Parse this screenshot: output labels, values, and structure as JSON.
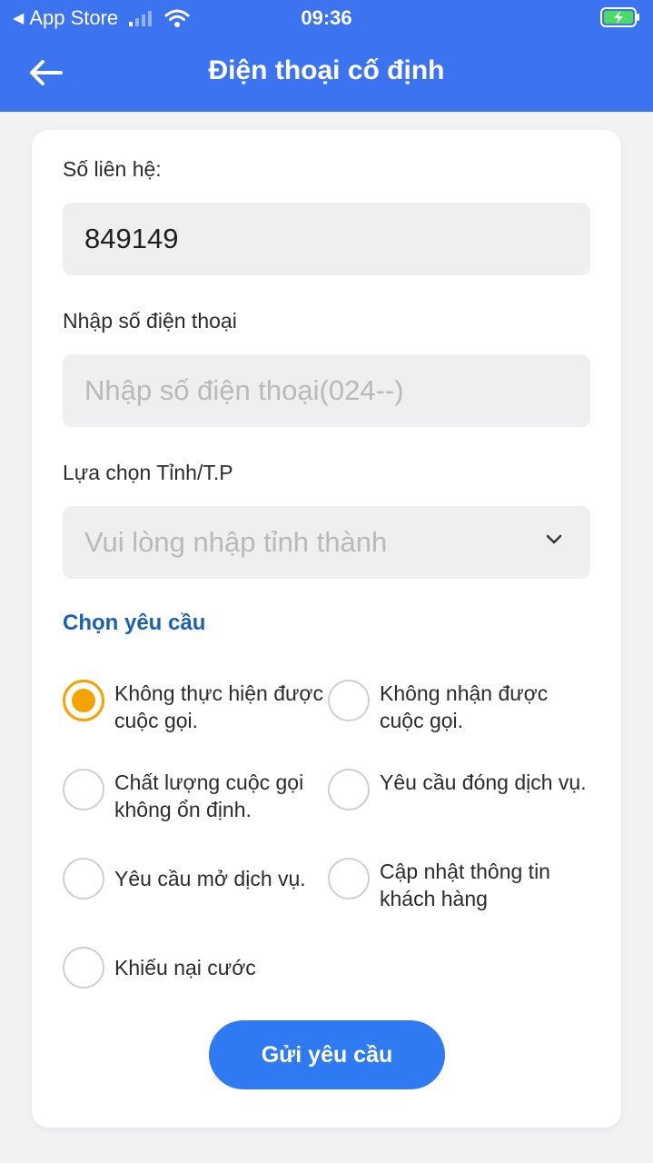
{
  "status_bar": {
    "back_app": "App Store",
    "time": "09:36"
  },
  "header": {
    "title": "Điện thoại cố định"
  },
  "form": {
    "contact_label": "Số liên hệ:",
    "contact_value": "849149",
    "phone_label": "Nhập số điện thoại",
    "phone_placeholder": "Nhập số điện thoại(024--)",
    "province_label": "Lựa chọn Tỉnh/T.P",
    "province_placeholder": "Vui lòng nhập tỉnh thành",
    "request_title": "Chọn yêu cầu",
    "options": [
      {
        "label": "Không thực hiện được cuộc gọi.",
        "checked": true
      },
      {
        "label": "Không nhận được cuộc gọi.",
        "checked": false
      },
      {
        "label": "Chất lượng cuộc gọi không ổn định.",
        "checked": false
      },
      {
        "label": "Yêu cầu đóng dịch vụ.",
        "checked": false
      },
      {
        "label": "Yêu cầu mở dịch vụ.",
        "checked": false
      },
      {
        "label": "Cập nhật thông tin khách hàng",
        "checked": false
      },
      {
        "label": "Khiếu nại cước",
        "checked": false
      }
    ],
    "submit_label": "Gửi yêu cầu"
  },
  "colors": {
    "header": "#3b73f0",
    "accent": "#f5a300",
    "button": "#2f7af2",
    "section_title": "#1d5fb0"
  }
}
